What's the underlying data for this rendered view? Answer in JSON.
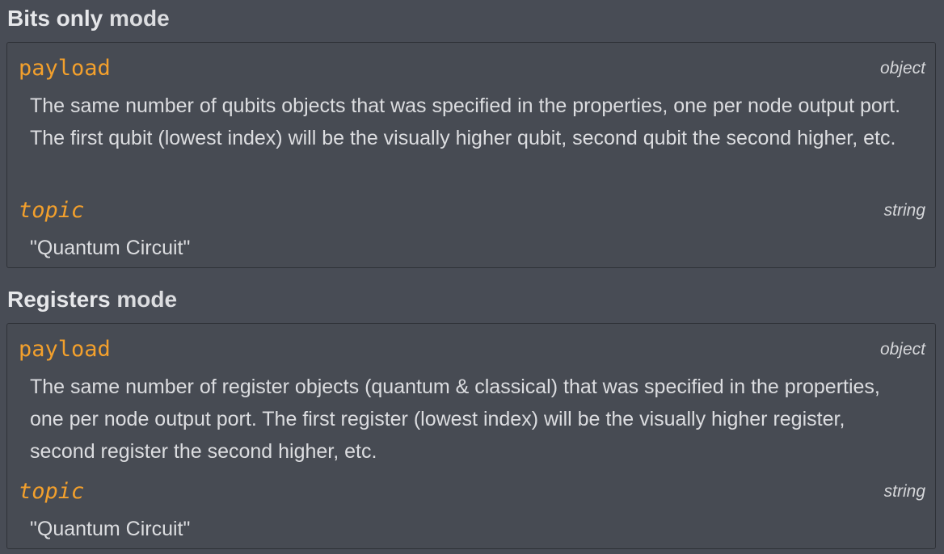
{
  "sections": [
    {
      "title_strong": "Bits only",
      "title_rest": " mode",
      "props": [
        {
          "name": "payload",
          "type": "object",
          "description": "The same number of qubits objects that was specified in the properties, one per node output port. The first qubit (lowest index) will be the visually higher qubit, second qubit the second higher, etc."
        },
        {
          "name": "topic",
          "type": "string",
          "description": "\"Quantum Circuit\""
        }
      ]
    },
    {
      "title_strong": "Registers",
      "title_rest": " mode",
      "props": [
        {
          "name": "payload",
          "type": "object",
          "description": "The same number of register objects (quantum & classical) that was specified in the properties, one per node output port. The first register (lowest index) will be the visually higher register, second register the second higher, etc."
        },
        {
          "name": "topic",
          "type": "string",
          "description": "\"Quantum Circuit\""
        }
      ]
    }
  ],
  "colors": {
    "background": "#484c55",
    "property_name": "#f3a02c",
    "text": "#dcdde0",
    "border": "#2f3238"
  }
}
